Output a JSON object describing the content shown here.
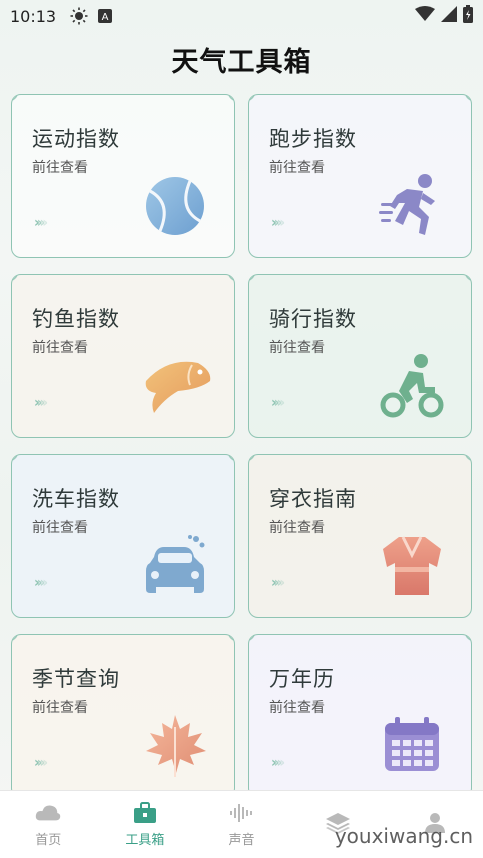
{
  "status": {
    "time": "10:13",
    "icons": [
      "sun-icon",
      "a-badge-icon",
      "wifi-icon",
      "signal-icon",
      "battery-icon"
    ]
  },
  "header": {
    "title": "天气工具箱"
  },
  "cards": [
    {
      "title": "运动指数",
      "sub": "前往查看",
      "arrows": "››››",
      "icon": "tennis-ball-icon"
    },
    {
      "title": "跑步指数",
      "sub": "前往查看",
      "arrows": "››››",
      "icon": "runner-icon"
    },
    {
      "title": "钓鱼指数",
      "sub": "前往查看",
      "arrows": "››››",
      "icon": "fish-icon"
    },
    {
      "title": "骑行指数",
      "sub": "前往查看",
      "arrows": "››››",
      "icon": "cyclist-icon"
    },
    {
      "title": "洗车指数",
      "sub": "前往查看",
      "arrows": "››››",
      "icon": "car-wash-icon"
    },
    {
      "title": "穿衣指南",
      "sub": "前往查看",
      "arrows": "››››",
      "icon": "kimono-icon"
    },
    {
      "title": "季节查询",
      "sub": "前往查看",
      "arrows": "››››",
      "icon": "maple-leaf-icon"
    },
    {
      "title": "万年历",
      "sub": "前往查看",
      "arrows": "››››",
      "icon": "calendar-icon"
    }
  ],
  "nav": {
    "items": [
      {
        "label": "首页",
        "icon": "cloud-icon",
        "active": false
      },
      {
        "label": "工具箱",
        "icon": "toolbox-icon",
        "active": true
      },
      {
        "label": "声音",
        "icon": "sound-wave-icon",
        "active": false
      },
      {
        "label": "",
        "icon": "layers-icon",
        "active": false
      },
      {
        "label": "",
        "icon": "person-icon",
        "active": false
      }
    ]
  },
  "watermark": "youxiwang.cn",
  "colors": {
    "accent": "#3a9f87",
    "card_border": "#8fc4b3"
  }
}
